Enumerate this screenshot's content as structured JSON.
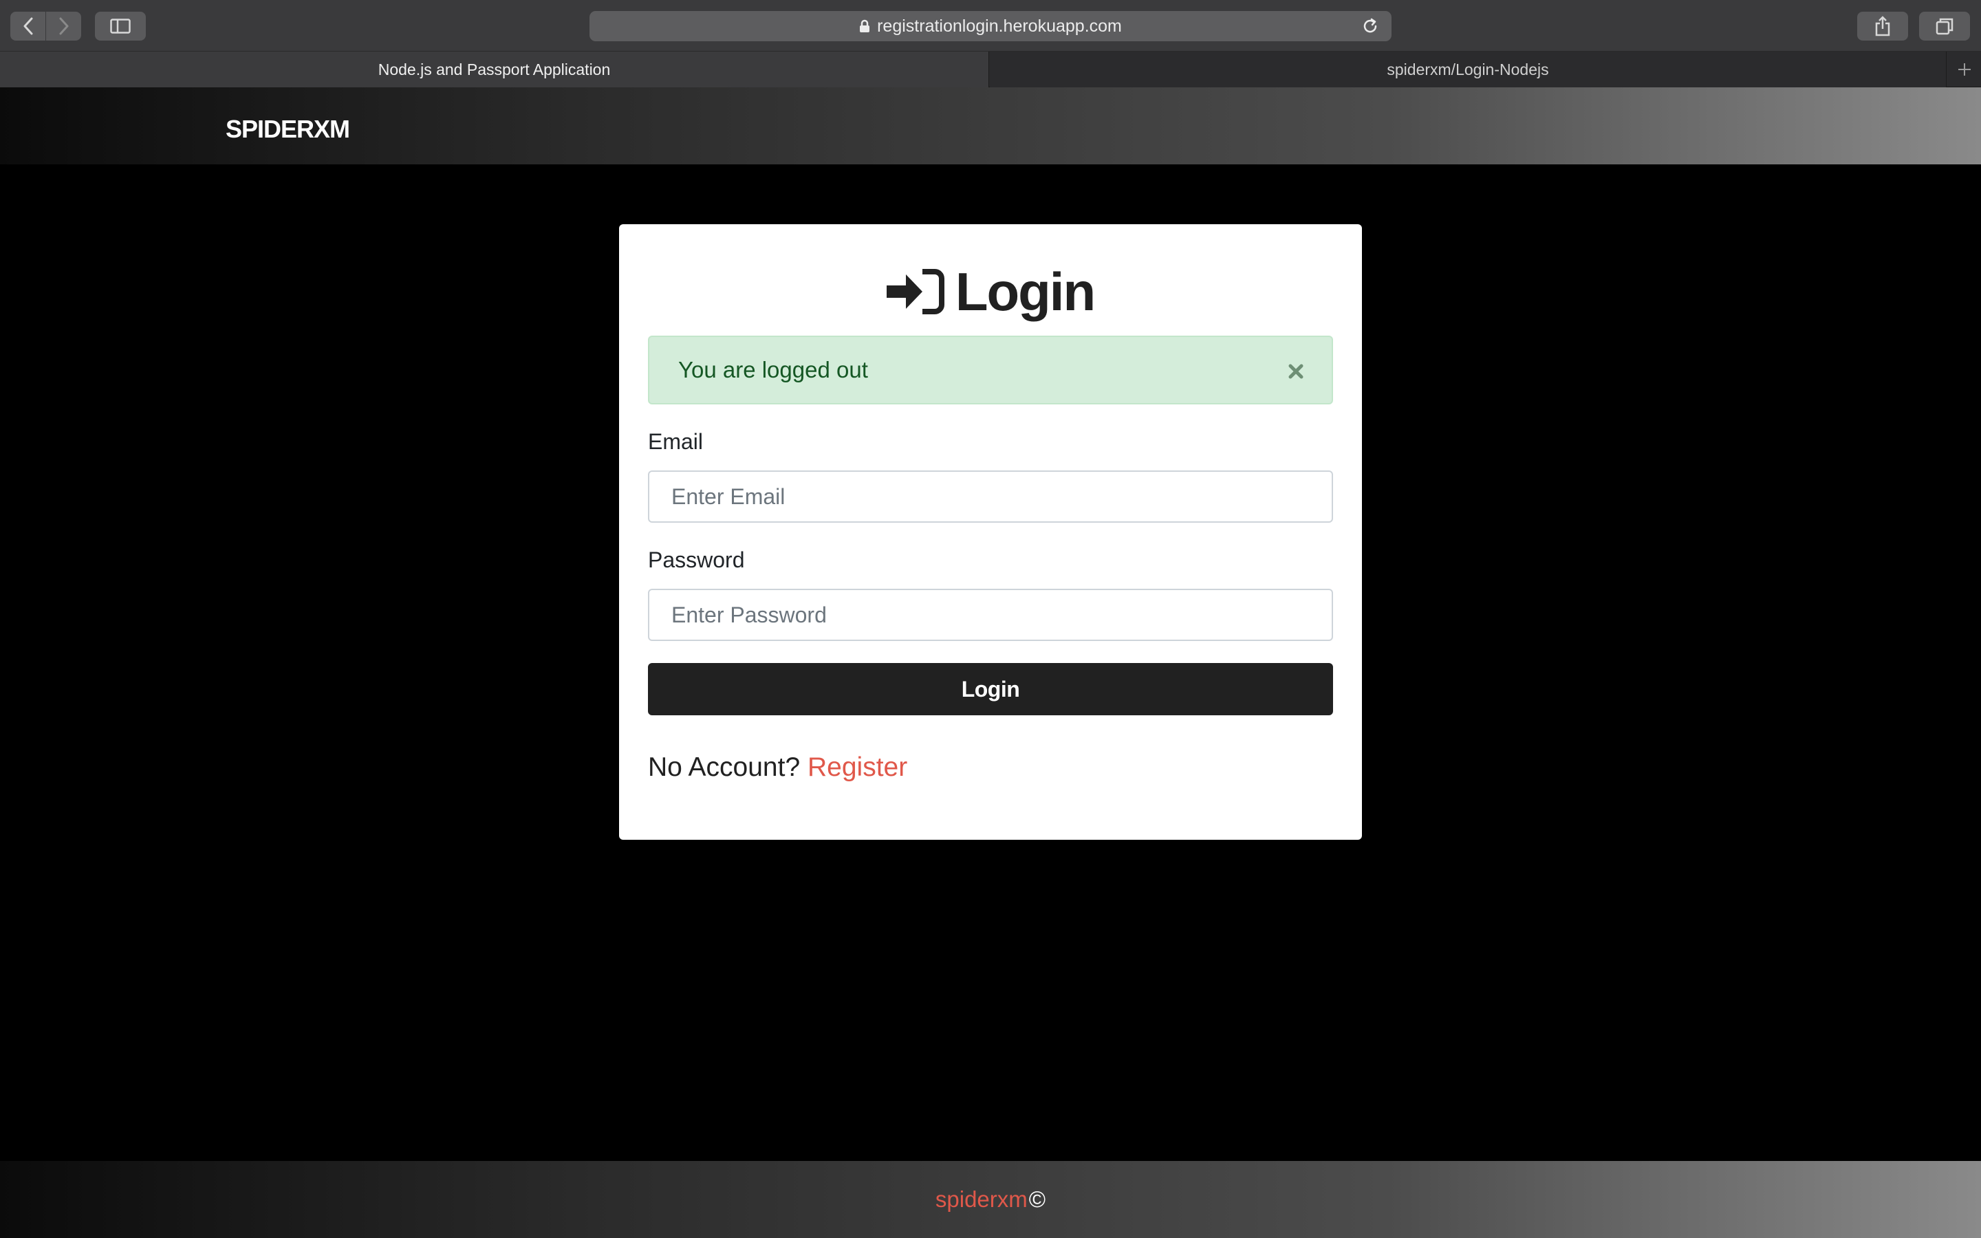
{
  "browser": {
    "url": "registrationlogin.herokuapp.com",
    "tabs": [
      {
        "label": "Node.js and Passport Application",
        "active": true
      },
      {
        "label": "spiderxm/Login-Nodejs",
        "active": false
      }
    ]
  },
  "site": {
    "brand": "SPIDERXM"
  },
  "login": {
    "title": "Login",
    "icon": "sign-in-icon",
    "alert": {
      "message": "You are logged out",
      "type": "success"
    },
    "email_label": "Email",
    "email_placeholder": "Enter Email",
    "email_value": "",
    "password_label": "Password",
    "password_placeholder": "Enter Password",
    "password_value": "",
    "submit_label": "Login",
    "no_account_text": "No Account?",
    "register_label": "Register"
  },
  "footer": {
    "brand": "spiderxm",
    "copyright": "©"
  },
  "colors": {
    "accent": "#e0584a",
    "alert_bg": "#d4edda",
    "alert_text": "#155724",
    "button_bg": "#212121"
  }
}
